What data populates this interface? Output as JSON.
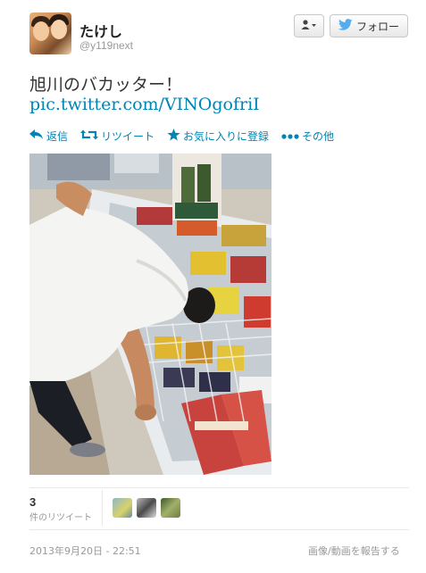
{
  "user": {
    "name": "たけし",
    "handle": "@y119next"
  },
  "buttons": {
    "follow_label": "フォロー"
  },
  "tweet": {
    "text": "旭川のバカッター！",
    "link": "pic.twitter.com/VINOgofriI"
  },
  "actions": {
    "reply": "返信",
    "retweet": "リツイート",
    "favorite": "お気に入りに登録",
    "more": "その他"
  },
  "stats": {
    "retweet_count": "3",
    "retweet_label": "件のリツイート"
  },
  "footer": {
    "timestamp": "2013年9月20日 - 22:51",
    "report": "画像/動画を報告する"
  },
  "colors": {
    "link": "#0084b4",
    "twitter_bird": "#55acee"
  },
  "icons": [
    "user-menu-icon",
    "twitter-bird-icon",
    "reply-icon",
    "retweet-icon",
    "star-icon",
    "more-dots-icon"
  ]
}
